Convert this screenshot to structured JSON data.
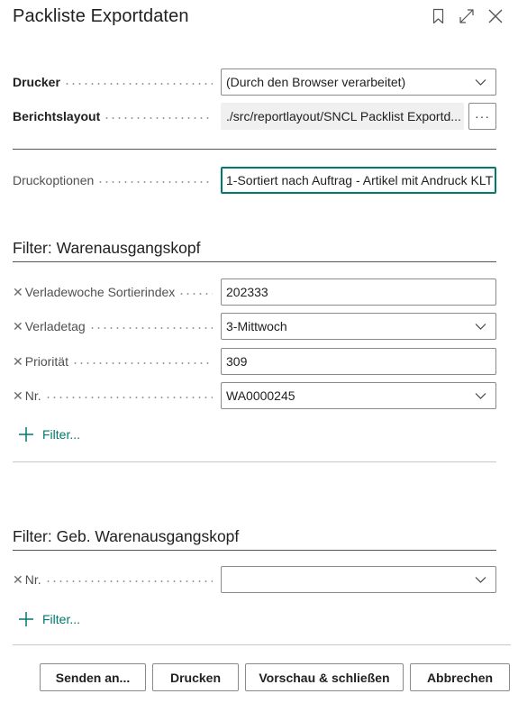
{
  "dialog": {
    "title": "Packliste Exportdaten"
  },
  "options": {
    "printer_label": "Drucker",
    "printer_value": "(Durch den Browser verarbeitet)",
    "layout_label": "Berichtslayout",
    "layout_value": "./src/reportlayout/SNCL Packlist Exportd...",
    "assist_label": "···",
    "print_options_label": "Druckoptionen",
    "print_options_value": "1-Sortiert nach Auftrag - Artikel mit Andruck KLT"
  },
  "filter1": {
    "title": "Filter: Warenausgangskopf",
    "fields": [
      {
        "label": "Verladewoche Sortierindex",
        "value": "202333"
      },
      {
        "label": "Verladetag",
        "value": "3-Mittwoch"
      },
      {
        "label": "Priorität",
        "value": "309"
      },
      {
        "label": "Nr.",
        "value": "WA0000245"
      }
    ],
    "add_filter": "Filter..."
  },
  "filter2": {
    "title": "Filter: Geb. Warenausgangskopf",
    "fields": [
      {
        "label": "Nr.",
        "value": ""
      }
    ],
    "add_filter": "Filter..."
  },
  "buttons": {
    "send": "Senden an...",
    "print": "Drucken",
    "preview": "Vorschau & schließen",
    "cancel": "Abbrechen"
  },
  "colors": {
    "accent": "#00796b",
    "text": "#212121",
    "border": "#8a8a8a"
  },
  "icons": [
    "bookmark-icon",
    "expand-icon",
    "close-icon",
    "chevron-down-icon",
    "plus-icon",
    "remove-filter-icon"
  ]
}
